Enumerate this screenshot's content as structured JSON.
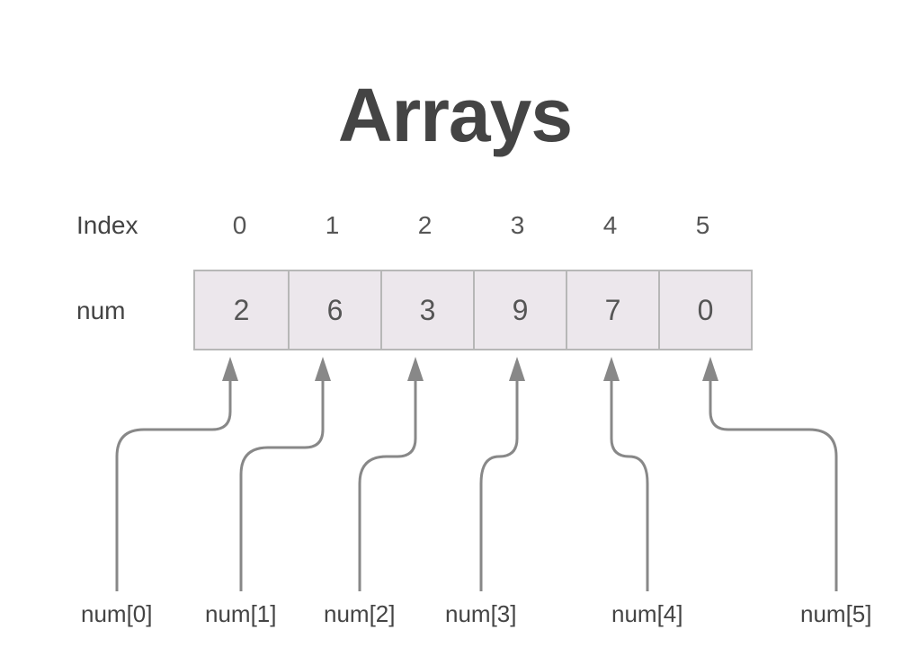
{
  "title": "Arrays",
  "index_label": "Index",
  "array_label": "num",
  "indices": [
    "0",
    "1",
    "2",
    "3",
    "4",
    "5"
  ],
  "values": [
    "2",
    "6",
    "3",
    "9",
    "7",
    "0"
  ],
  "access_labels": [
    "num[0]",
    "num[1]",
    "num[2]",
    "num[3]",
    "num[4]",
    "num[5]"
  ],
  "chart_data": {
    "type": "table",
    "title": "Arrays",
    "array_name": "num",
    "indices": [
      0,
      1,
      2,
      3,
      4,
      5
    ],
    "values": [
      2,
      6,
      3,
      9,
      7,
      0
    ],
    "access_expressions": [
      "num[0]",
      "num[1]",
      "num[2]",
      "num[3]",
      "num[4]",
      "num[5]"
    ]
  }
}
